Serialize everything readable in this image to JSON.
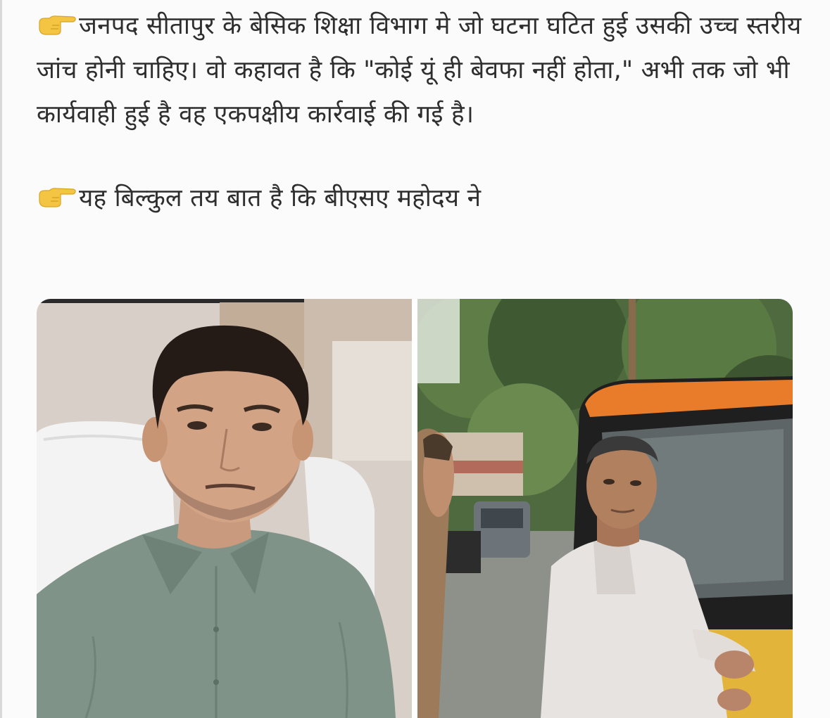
{
  "post": {
    "bullet_icon": "backhand-index-pointing-right-emoji",
    "paragraph_1": "जनपद सीतापुर के बेसिक शिक्षा विभाग मे जो घटना घटित हुई उसकी उच्च स्तरीय जांच होनी चाहिए। वो कहावत है कि \"कोई यूं ही बेवफा नहीं होता,\"  अभी तक जो भी कार्यवाही हुई है वह एकपक्षीय कार्रवाई की गई है।",
    "paragraph_2": "यह बिल्कुल तय बात है कि बीएसए महोदय ने"
  },
  "media": {
    "images": [
      {
        "name": "office-portrait-photo"
      },
      {
        "name": "outdoor-man-near-van-photo"
      }
    ]
  },
  "colors": {
    "background": "#fbfbfb",
    "text": "#2e2e2e",
    "emoji_hand": "#f4c542"
  }
}
